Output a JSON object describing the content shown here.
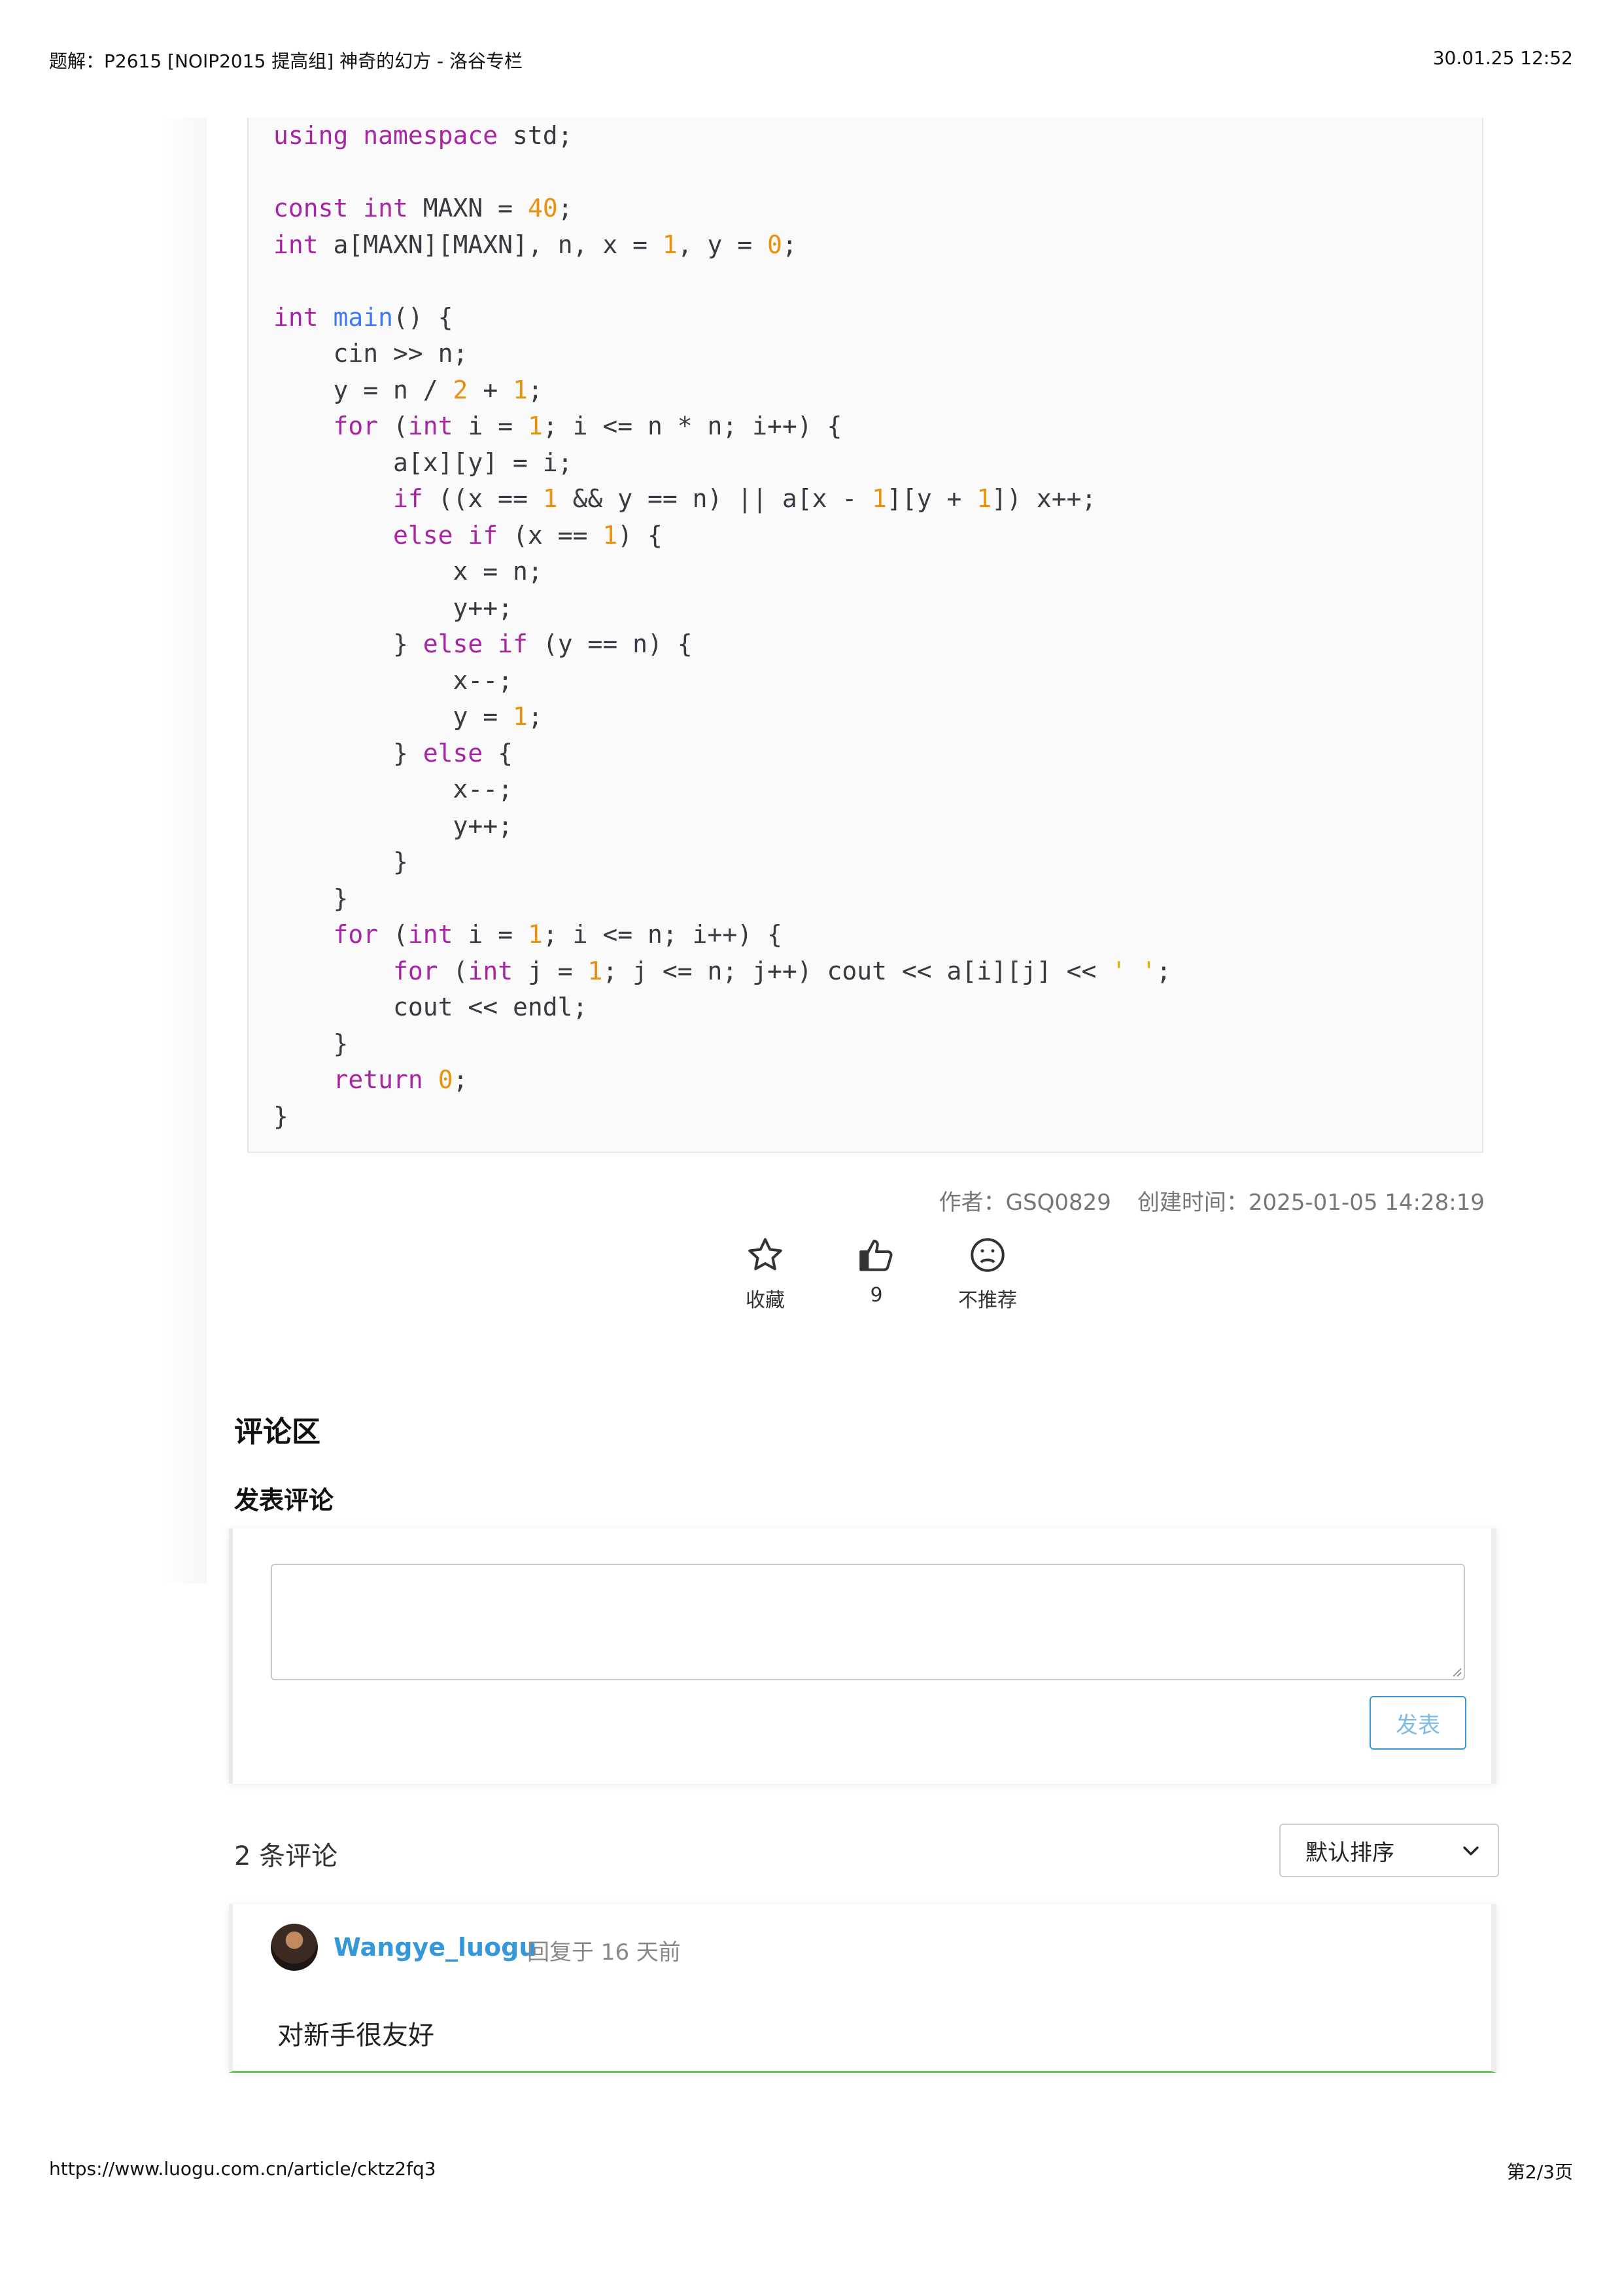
{
  "print_header": {
    "title": "题解：P2615 [NOIP2015 提高组] 神奇的幻方 - 洛谷专栏",
    "datetime": "30.01.25 12:52"
  },
  "print_footer": {
    "url": "https://www.luogu.com.cn/article/cktz2fq3",
    "page": "第2/3页"
  },
  "code": {
    "lines": [
      [
        {
          "t": "using namespace",
          "c": "kw"
        },
        {
          "t": " std;",
          "c": "plain"
        }
      ],
      [],
      [
        {
          "t": "const int",
          "c": "kw"
        },
        {
          "t": " MAXN = ",
          "c": "plain"
        },
        {
          "t": "40",
          "c": "num"
        },
        {
          "t": ";",
          "c": "plain"
        }
      ],
      [
        {
          "t": "int",
          "c": "kw"
        },
        {
          "t": " a[MAXN][MAXN], n, x = ",
          "c": "plain"
        },
        {
          "t": "1",
          "c": "num"
        },
        {
          "t": ", y = ",
          "c": "plain"
        },
        {
          "t": "0",
          "c": "num"
        },
        {
          "t": ";",
          "c": "plain"
        }
      ],
      [],
      [
        {
          "t": "int",
          "c": "kw"
        },
        {
          "t": " ",
          "c": "plain"
        },
        {
          "t": "main",
          "c": "fn"
        },
        {
          "t": "() {",
          "c": "plain"
        }
      ],
      [
        {
          "t": "    cin >> n;",
          "c": "plain"
        }
      ],
      [
        {
          "t": "    y = n / ",
          "c": "plain"
        },
        {
          "t": "2",
          "c": "num"
        },
        {
          "t": " + ",
          "c": "plain"
        },
        {
          "t": "1",
          "c": "num"
        },
        {
          "t": ";",
          "c": "plain"
        }
      ],
      [
        {
          "t": "    ",
          "c": "plain"
        },
        {
          "t": "for",
          "c": "kw"
        },
        {
          "t": " (",
          "c": "plain"
        },
        {
          "t": "int",
          "c": "kw"
        },
        {
          "t": " i = ",
          "c": "plain"
        },
        {
          "t": "1",
          "c": "num"
        },
        {
          "t": "; i <= n * n; i++) {",
          "c": "plain"
        }
      ],
      [
        {
          "t": "        a[x][y] = i;",
          "c": "plain"
        }
      ],
      [
        {
          "t": "        ",
          "c": "plain"
        },
        {
          "t": "if",
          "c": "kw"
        },
        {
          "t": " ((x == ",
          "c": "plain"
        },
        {
          "t": "1",
          "c": "num"
        },
        {
          "t": " && y == n) || a[x - ",
          "c": "plain"
        },
        {
          "t": "1",
          "c": "num"
        },
        {
          "t": "][y + ",
          "c": "plain"
        },
        {
          "t": "1",
          "c": "num"
        },
        {
          "t": "]) x++;",
          "c": "plain"
        }
      ],
      [
        {
          "t": "        ",
          "c": "plain"
        },
        {
          "t": "else if",
          "c": "kw"
        },
        {
          "t": " (x == ",
          "c": "plain"
        },
        {
          "t": "1",
          "c": "num"
        },
        {
          "t": ") {",
          "c": "plain"
        }
      ],
      [
        {
          "t": "            x = n;",
          "c": "plain"
        }
      ],
      [
        {
          "t": "            y++;",
          "c": "plain"
        }
      ],
      [
        {
          "t": "        } ",
          "c": "plain"
        },
        {
          "t": "else if",
          "c": "kw"
        },
        {
          "t": " (y == n) {",
          "c": "plain"
        }
      ],
      [
        {
          "t": "            x--;",
          "c": "plain"
        }
      ],
      [
        {
          "t": "            y = ",
          "c": "plain"
        },
        {
          "t": "1",
          "c": "num"
        },
        {
          "t": ";",
          "c": "plain"
        }
      ],
      [
        {
          "t": "        } ",
          "c": "plain"
        },
        {
          "t": "else",
          "c": "kw"
        },
        {
          "t": " {",
          "c": "plain"
        }
      ],
      [
        {
          "t": "            x--;",
          "c": "plain"
        }
      ],
      [
        {
          "t": "            y++;",
          "c": "plain"
        }
      ],
      [
        {
          "t": "        }",
          "c": "plain"
        }
      ],
      [
        {
          "t": "    }",
          "c": "plain"
        }
      ],
      [
        {
          "t": "    ",
          "c": "plain"
        },
        {
          "t": "for",
          "c": "kw"
        },
        {
          "t": " (",
          "c": "plain"
        },
        {
          "t": "int",
          "c": "kw"
        },
        {
          "t": " i = ",
          "c": "plain"
        },
        {
          "t": "1",
          "c": "num"
        },
        {
          "t": "; i <= n; i++) {",
          "c": "plain"
        }
      ],
      [
        {
          "t": "        ",
          "c": "plain"
        },
        {
          "t": "for",
          "c": "kw"
        },
        {
          "t": " (",
          "c": "plain"
        },
        {
          "t": "int",
          "c": "kw"
        },
        {
          "t": " j = ",
          "c": "plain"
        },
        {
          "t": "1",
          "c": "num"
        },
        {
          "t": "; j <= n; j++) cout << a[i][j] << ",
          "c": "plain"
        },
        {
          "t": "' '",
          "c": "str"
        },
        {
          "t": ";",
          "c": "plain"
        }
      ],
      [
        {
          "t": "        cout << endl;",
          "c": "plain"
        }
      ],
      [
        {
          "t": "    }",
          "c": "plain"
        }
      ],
      [
        {
          "t": "    ",
          "c": "plain"
        },
        {
          "t": "return",
          "c": "kw"
        },
        {
          "t": " ",
          "c": "plain"
        },
        {
          "t": "0",
          "c": "num"
        },
        {
          "t": ";",
          "c": "plain"
        }
      ],
      [
        {
          "t": "}",
          "c": "plain"
        }
      ]
    ]
  },
  "meta": {
    "author": "作者：GSQ0829",
    "created": "创建时间：2025-01-05 14:28:19"
  },
  "actions": {
    "favorite_label": "收藏",
    "like_count": "9",
    "dislike_label": "不推荐",
    "favorite_icon": "star-icon",
    "like_icon": "thumbs-up-icon",
    "dislike_icon": "frown-icon"
  },
  "comments": {
    "section_title": "评论区",
    "compose_title": "发表评论",
    "input_placeholder": "",
    "submit_label": "发表",
    "count_label": "2 条评论",
    "sort_selected": "默认排序",
    "items": [
      {
        "user": "Wangye_luogu",
        "time": "回复于 16 天前",
        "text": "对新手很友好"
      }
    ]
  },
  "colors": {
    "keyword": "#a626a4",
    "number": "#e8920f",
    "string": "#e5b000",
    "link": "#3498db",
    "comment_accent": "#6fbf5b"
  }
}
